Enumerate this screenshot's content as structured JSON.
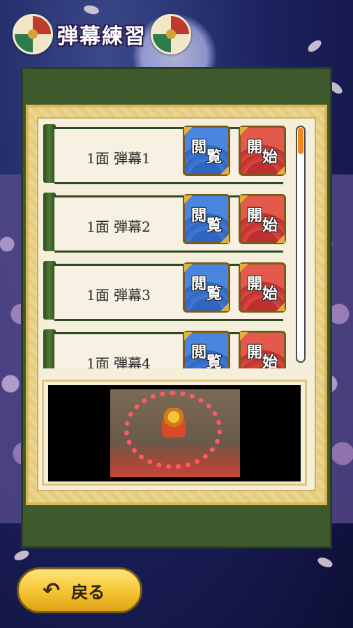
{
  "header": {
    "title": "弾幕練習"
  },
  "danmaku_list": [
    {
      "label": "1面 弾幕1",
      "view_label": [
        "閲",
        "覧"
      ],
      "start_label": [
        "開",
        "始"
      ]
    },
    {
      "label": "1面 弾幕2",
      "view_label": [
        "閲",
        "覧"
      ],
      "start_label": [
        "開",
        "始"
      ]
    },
    {
      "label": "1面 弾幕3",
      "view_label": [
        "閲",
        "覧"
      ],
      "start_label": [
        "開",
        "始"
      ]
    },
    {
      "label": "1面 弾幕4",
      "view_label": [
        "閲",
        "覧"
      ],
      "start_label": [
        "開",
        "始"
      ]
    }
  ],
  "scroll": {
    "position": 0.0
  },
  "footer": {
    "back_label": "戻る",
    "back_icon": "undo-arrow-icon"
  },
  "colors": {
    "view_button": "#3f79d6",
    "start_button": "#d94a3f",
    "scroll_thumb": "#ef8a1a",
    "back_button": "#f4c431"
  }
}
